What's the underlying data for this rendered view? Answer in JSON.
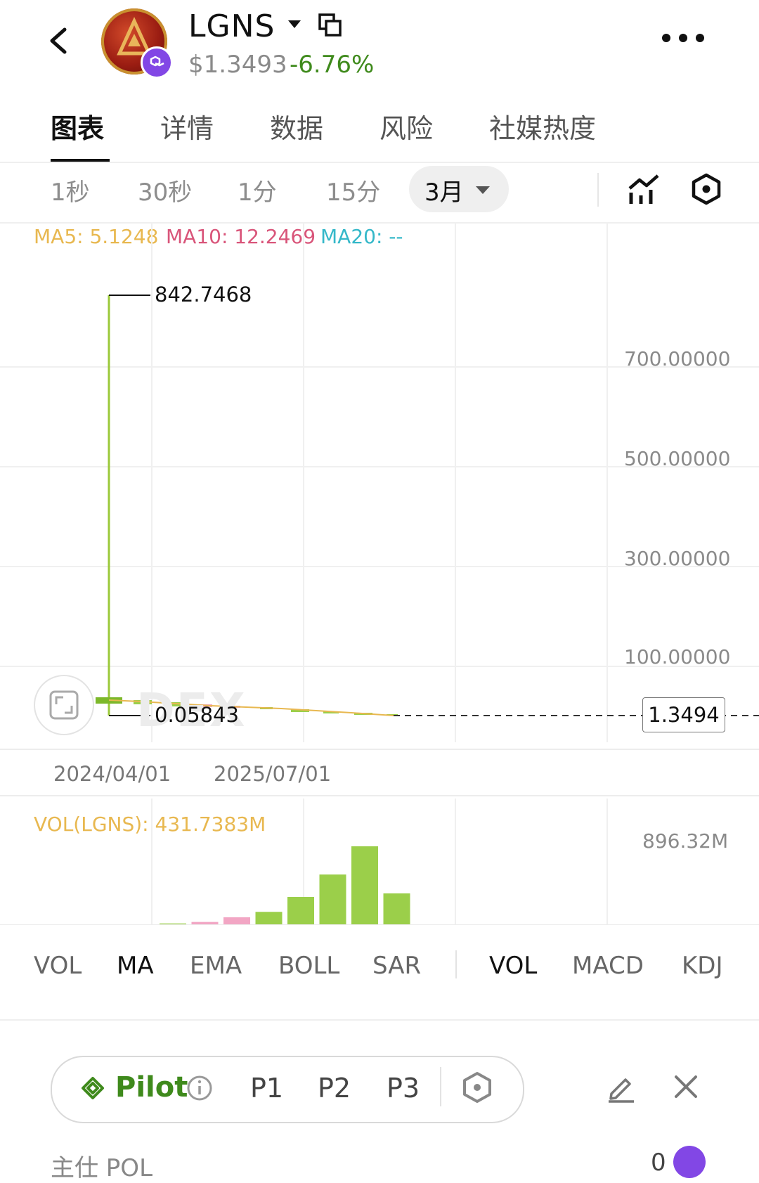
{
  "header": {
    "token_symbol": "LGNS",
    "price": "$1.3493",
    "change": "-6.76%",
    "icons": [
      "back-icon",
      "token-logo",
      "polygon-chain-icon",
      "dropdown-caret-icon",
      "copy-icon",
      "more-icon"
    ]
  },
  "tabs": [
    "图表",
    "详情",
    "数据",
    "风险",
    "社媒热度"
  ],
  "timeframes": [
    "1秒",
    "30秒",
    "1分",
    "15分"
  ],
  "timeframe_selected": "3月",
  "ma": {
    "ma5": "MA5: 5.1248",
    "ma10": "MA10: 12.2469",
    "ma20": "MA20: --"
  },
  "colors": {
    "ma5": "#e8b850",
    "ma10": "#d9557a",
    "ma20": "#35b8c9",
    "up": "#9bcf4a",
    "down": "#f2a6c4",
    "change": "#3f8a1c",
    "accent": "#8247e5"
  },
  "chart_data": {
    "type": "candlestick",
    "y_ticks": [
      "700.00000",
      "500.00000",
      "300.00000",
      "100.00000"
    ],
    "ylim": [
      0,
      842.7468
    ],
    "high_label": "842.7468",
    "low_label": "0.05843",
    "current_price": "1.3494",
    "x_ticks": [
      "2024/04/01",
      "2025/07/01"
    ],
    "watermark": "DEX",
    "volume": {
      "label": "VOL(LGNS): 431.7383M",
      "max_label": "896.32M",
      "max": 896.32,
      "values": [
        5,
        8,
        18,
        35,
        88,
        150,
        320,
        575,
        896.32,
        360
      ],
      "colors": [
        "up",
        "up",
        "up",
        "down",
        "down",
        "up",
        "up",
        "up",
        "up",
        "up"
      ]
    }
  },
  "indicators_main": [
    "VOL",
    "MA",
    "EMA",
    "BOLL",
    "SAR"
  ],
  "indicators_sub": [
    "VOL",
    "MACD",
    "KDJ"
  ],
  "pilot": {
    "label": "Pilot",
    "presets": [
      "P1",
      "P2",
      "P3"
    ]
  },
  "bottom": {
    "left_text": "主仕 POL",
    "right_text": "0"
  }
}
